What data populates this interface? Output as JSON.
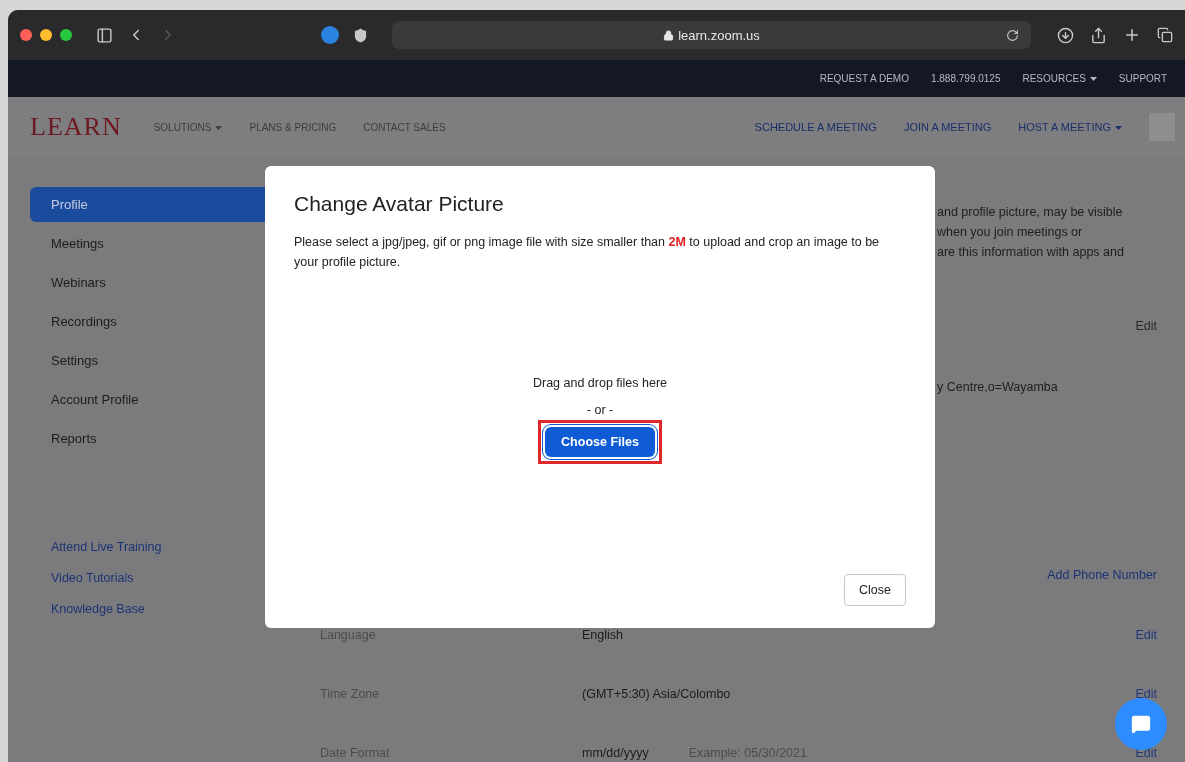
{
  "browser": {
    "url": "learn.zoom.us"
  },
  "top_bar": {
    "links": [
      {
        "label": "REQUEST A DEMO",
        "dropdown": false
      },
      {
        "label": "1.888.799.0125",
        "dropdown": false
      },
      {
        "label": "RESOURCES",
        "dropdown": true
      },
      {
        "label": "SUPPORT",
        "dropdown": false
      }
    ]
  },
  "nav": {
    "logo": "LEARN",
    "left_links": [
      {
        "label": "SOLUTIONS",
        "dropdown": true
      },
      {
        "label": "PLANS & PRICING",
        "dropdown": false
      },
      {
        "label": "CONTACT SALES",
        "dropdown": false
      }
    ],
    "right_links": [
      {
        "label": "SCHEDULE A MEETING",
        "dropdown": false
      },
      {
        "label": "JOIN A MEETING",
        "dropdown": false
      },
      {
        "label": "HOST A MEETING",
        "dropdown": true
      }
    ]
  },
  "sidebar": {
    "items": [
      {
        "label": "Profile",
        "selected": true
      },
      {
        "label": "Meetings",
        "selected": false
      },
      {
        "label": "Webinars",
        "selected": false
      },
      {
        "label": "Recordings",
        "selected": false
      },
      {
        "label": "Settings",
        "selected": false
      },
      {
        "label": "Account Profile",
        "selected": false
      },
      {
        "label": "Reports",
        "selected": false
      }
    ],
    "links": [
      "Attend Live Training",
      "Video Tutorials",
      "Knowledge Base"
    ]
  },
  "profile": {
    "notice_lines": [
      "and profile picture, may be visible",
      "when you join meetings or",
      "are this information with apps and"
    ],
    "edit": "Edit",
    "organization": "y Centre,o=Wayamba",
    "add_phone": "Add Phone Number",
    "rows": [
      {
        "label": "Language",
        "value": "English",
        "edit": "Edit"
      },
      {
        "label": "Time Zone",
        "value": "(GMT+5:30) Asia/Colombo",
        "edit": "Edit"
      },
      {
        "label": "Date Format",
        "value": "mm/dd/yyyy",
        "example": "Example: 05/30/2021",
        "edit": "Edit"
      }
    ]
  },
  "dialog": {
    "title": "Change Avatar Picture",
    "message": "Please select a jpg/jpeg, gif or png image file with size smaller than **2M** to upload and crop an image to be your profile picture.",
    "drop_hint": "Drag and drop files here",
    "separator": "- or -",
    "choose_button": {
      "label": "Choose Files",
      "highlighted": true
    },
    "close_button": "Close"
  }
}
